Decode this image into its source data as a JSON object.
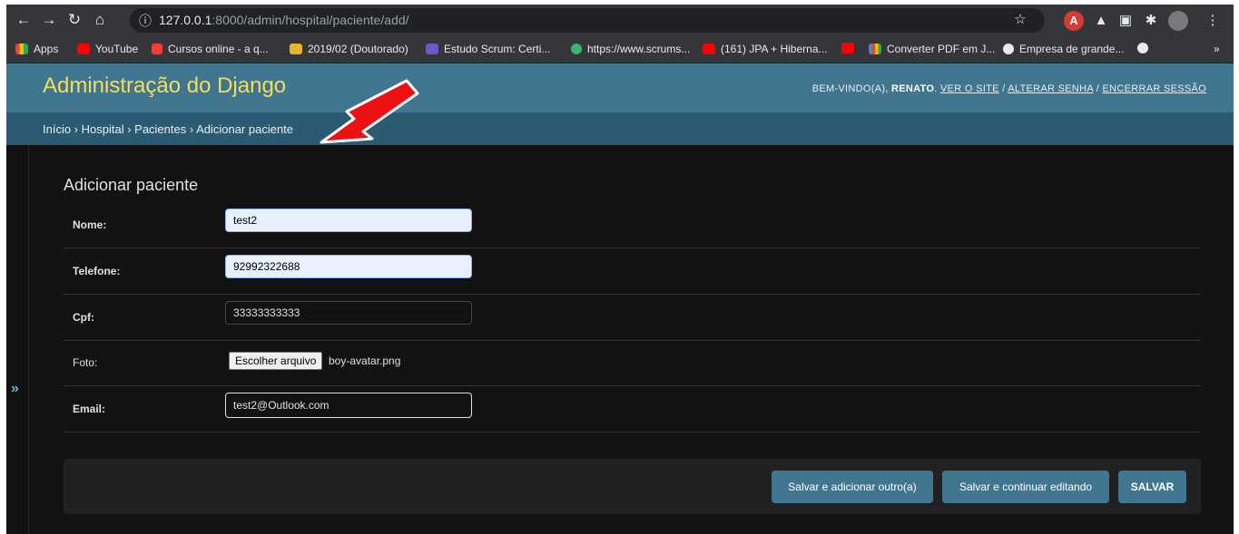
{
  "browser": {
    "url_host": "127.0.0.1",
    "url_rest": ":8000/admin/hospital/paciente/add/",
    "bookmarks": [
      {
        "label": "Apps",
        "icon": "apps-grid-icon"
      },
      {
        "label": "YouTube",
        "icon": "youtube-icon"
      },
      {
        "label": "Cursos online - a q...",
        "icon": "udemy-icon"
      },
      {
        "label": "2019/02 (Doutorado)",
        "icon": "drive-icon"
      },
      {
        "label": "Estudo Scrum: Certi...",
        "icon": "scrum-icon"
      },
      {
        "label": "https://www.scrums...",
        "icon": "check-icon"
      },
      {
        "label": "(161) JPA + Hiberna...",
        "icon": "youtube-icon"
      },
      {
        "label": "",
        "icon": "youtube-icon"
      },
      {
        "label": "Converter PDF em J...",
        "icon": "converter-icon"
      },
      {
        "label": "Empresa de grande...",
        "icon": "globe-icon"
      }
    ],
    "more_bookmarks": "»"
  },
  "header": {
    "site_title": "Administração do Django",
    "welcome": "BEM-VINDO(A),",
    "username": "RENATO",
    "view_site": "VER O SITE",
    "change_password": "ALTERAR SENHA",
    "logout": "ENCERRAR SESSÃO"
  },
  "breadcrumbs": "Início › Hospital › Pacientes › Adicionar paciente",
  "sidebar_toggle": "»",
  "content": {
    "title": "Adicionar paciente",
    "fields": {
      "nome": {
        "label": "Nome:",
        "value": "test2"
      },
      "telefone": {
        "label": "Telefone:",
        "value": "92992322688"
      },
      "cpf": {
        "label": "Cpf:",
        "value": "33333333333"
      },
      "foto": {
        "label": "Foto:",
        "button": "Escolher arquivo",
        "file": "boy-avatar.png"
      },
      "email": {
        "label": "Email:",
        "value": "test2@Outlook.com"
      }
    }
  },
  "submit": {
    "save_add_another": "Salvar e adicionar outro(a)",
    "save_continue": "Salvar e continuar editando",
    "save": "SALVAR"
  },
  "colors": {
    "header_bg": "#417690",
    "breadcrumb_bg": "#2b5b73",
    "site_title": "#f5dd5d",
    "button_bg": "#417690",
    "arrow": "#ee1111"
  }
}
